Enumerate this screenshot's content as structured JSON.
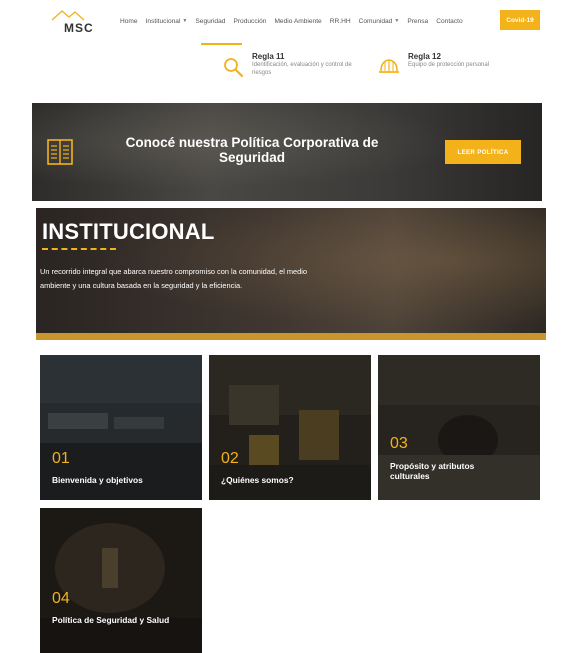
{
  "header": {
    "logo_text": "MSC",
    "nav": [
      {
        "label": "Home",
        "has_dropdown": false
      },
      {
        "label": "Institucional",
        "has_dropdown": true
      },
      {
        "label": "Seguridad",
        "has_dropdown": false
      },
      {
        "label": "Producción",
        "has_dropdown": false
      },
      {
        "label": "Medio Ambiente",
        "has_dropdown": false
      },
      {
        "label": "RR.HH",
        "has_dropdown": false
      },
      {
        "label": "Comunidad",
        "has_dropdown": true
      },
      {
        "label": "Prensa",
        "has_dropdown": false
      },
      {
        "label": "Contacto",
        "has_dropdown": false
      }
    ],
    "covid_label": "Covid-19",
    "active_item": "Seguridad"
  },
  "rules": [
    {
      "title": "Regla 11",
      "description": "Identificación, evaluación y control de riesgos",
      "icon": "magnifier-icon"
    },
    {
      "title": "Regla 12",
      "description": "Equipo de protección personal",
      "icon": "hard-hat-icon"
    }
  ],
  "policy_banner": {
    "text": "Conocé nuestra Política Corporativa de Seguridad",
    "button_label": "LEER POLÍTICA",
    "icon": "book-icon"
  },
  "hero": {
    "title": "INSTITUCIONAL",
    "description": "Un recorrido integral que abarca nuestro compromiso con la comunidad, el medio ambiente y una cultura basada en la seguridad y la eficiencia."
  },
  "cards": [
    {
      "number": "01",
      "label": "Bienvenida y objetivos"
    },
    {
      "number": "02",
      "label": "¿Quiénes somos?"
    },
    {
      "number": "03",
      "label": "Propósito y atributos culturales"
    },
    {
      "number": "04",
      "label": "Política de Seguridad y Salud"
    }
  ],
  "colors": {
    "accent": "#f4b21a",
    "hero_bar": "#c9962d",
    "text_dark": "#333333"
  }
}
